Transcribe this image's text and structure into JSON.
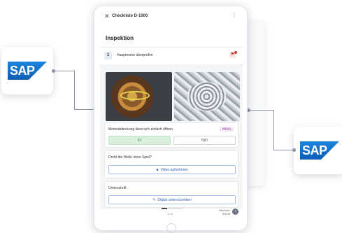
{
  "brand": {
    "logo_text": "SAP",
    "logo_color": "#1a74c9"
  },
  "app": {
    "title": "Checkliste D-1000",
    "close_icon": "close-icon",
    "menu_icon": "more-vertical-icon"
  },
  "section": {
    "title": "Inspektion"
  },
  "checklist_item": {
    "number": "1",
    "label": "Hauptmotor überprüfen",
    "badge_count": "1"
  },
  "questions": [
    {
      "label": "Motorabdeckung lässt sich einfach öffnen",
      "tag": "Pflicht",
      "options": [
        "IO",
        "NIO"
      ],
      "selected": "IO"
    },
    {
      "label": "Dreht die Welle ohne Spiel?",
      "action_label": "Video aufnehmen",
      "action_icon": "video-camera-icon"
    },
    {
      "label": "Unterschrift",
      "action_label": "Digital unterschreiben",
      "action_icon": "signature-icon"
    }
  ],
  "footer": {
    "page": "1 / 4",
    "next_label_line1": "Nächster",
    "next_label_line2": "Schritt",
    "next_icon": "arrow-right-icon"
  },
  "colors": {
    "accent": "#2d5fb8",
    "success_bg": "#d9f0dd",
    "success_text": "#3a8a4a",
    "tag_bg": "#f3e6f6",
    "tag_text": "#8b3a99"
  }
}
